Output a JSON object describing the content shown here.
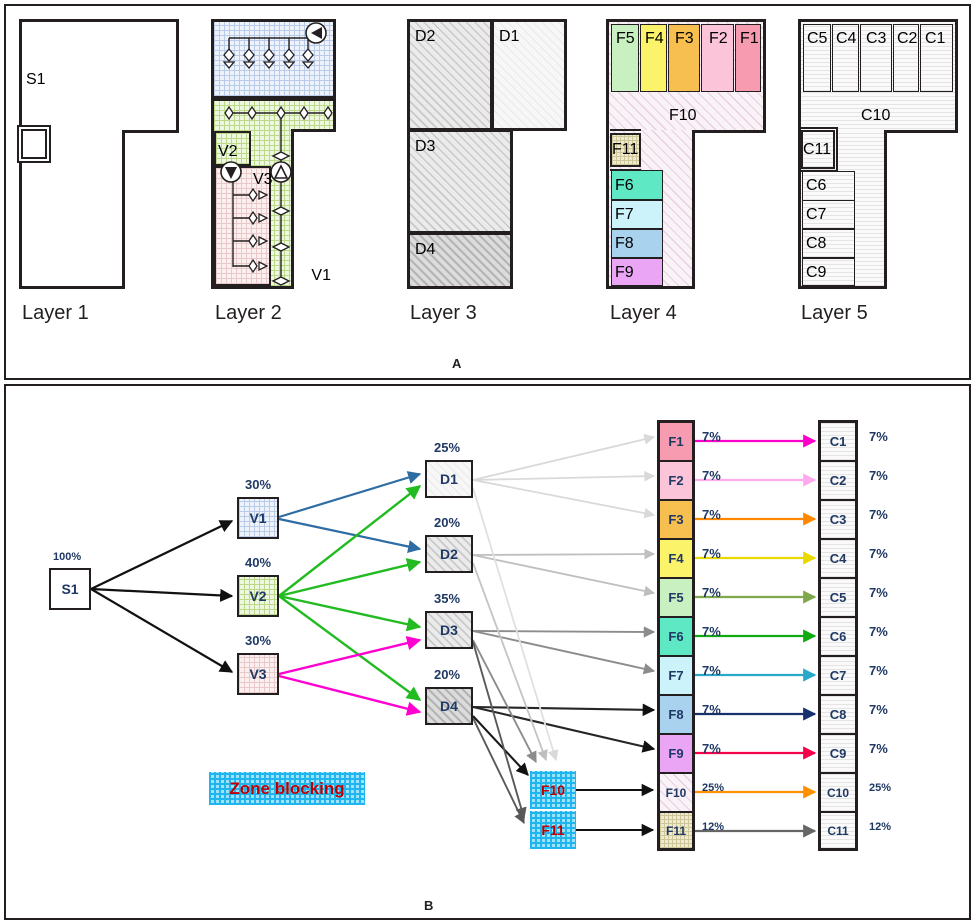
{
  "figure": {
    "panel_a_letter": "A",
    "panel_b_letter": "B"
  },
  "panel_a": {
    "captions": [
      "Layer 1",
      "Layer 2",
      "Layer 3",
      "Layer 4",
      "Layer 5"
    ],
    "layer1": {
      "rooms": [
        {
          "id": "S1"
        }
      ],
      "inset_label": ""
    },
    "layer2": {
      "zones": [
        {
          "id": "V1",
          "color": "#eef3fb"
        },
        {
          "id": "V2",
          "color": "#eef7e0"
        },
        {
          "id": "V3",
          "color": "#fbeff0"
        }
      ],
      "icons": [
        "pump-icon",
        "fan-icon",
        "damper-icon",
        "diffuser-icon"
      ]
    },
    "layer3": {
      "rooms": [
        "D2",
        "D1",
        "D3",
        "D4"
      ]
    },
    "layer4": {
      "top_rooms": [
        {
          "id": "F5",
          "color": "#c8f0c0"
        },
        {
          "id": "F4",
          "color": "#fbf46a"
        },
        {
          "id": "F3",
          "color": "#f6bf4f"
        },
        {
          "id": "F2",
          "color": "#fbc4d8"
        },
        {
          "id": "F1",
          "color": "#f79cb0"
        }
      ],
      "corridor": {
        "id": "F10"
      },
      "left_rooms": [
        {
          "id": "F11",
          "color": "#eeead0"
        },
        {
          "id": "F6",
          "color": "#5fe8c4"
        },
        {
          "id": "F7",
          "color": "#ccf3fa"
        },
        {
          "id": "F8",
          "color": "#a9d2ee"
        },
        {
          "id": "F9",
          "color": "#eaa6f4"
        }
      ]
    },
    "layer5": {
      "top_rooms": [
        "C5",
        "C4",
        "C3",
        "C2",
        "C1"
      ],
      "corridor": "C10",
      "left_rooms": [
        "C11",
        "C6",
        "C7",
        "C8",
        "C9"
      ]
    }
  },
  "panel_b": {
    "source": {
      "id": "S1",
      "pct": "100%"
    },
    "ahus": [
      {
        "id": "V1",
        "pct": "30%",
        "color": "#eef3fb",
        "arrow_color": "#2e6da4"
      },
      {
        "id": "V2",
        "pct": "40%",
        "color": "#eef7e0",
        "arrow_color": "#22bb22"
      },
      {
        "id": "V3",
        "pct": "30%",
        "color": "#fbeff0",
        "arrow_color": "#ff00d0"
      }
    ],
    "dampers": [
      {
        "id": "D1",
        "pct": "25%"
      },
      {
        "id": "D2",
        "pct": "20%"
      },
      {
        "id": "D3",
        "pct": "35%"
      },
      {
        "id": "D4",
        "pct": "20%"
      }
    ],
    "zone_blocking_nodes": [
      {
        "id": "F10"
      },
      {
        "id": "F11"
      }
    ],
    "legend": {
      "label": "Zone blocking"
    },
    "rooms": [
      {
        "f": "F1",
        "f_pct": "7%",
        "c": "C1",
        "c_pct": "7%",
        "color": "#f79cb0",
        "link": "#ff00cc"
      },
      {
        "f": "F2",
        "f_pct": "7%",
        "c": "C2",
        "c_pct": "7%",
        "color": "#fbc4d8",
        "link": "#ffaaee"
      },
      {
        "f": "F3",
        "f_pct": "7%",
        "c": "C3",
        "c_pct": "7%",
        "color": "#f6bf4f",
        "link": "#ff8800"
      },
      {
        "f": "F4",
        "f_pct": "7%",
        "c": "C4",
        "c_pct": "7%",
        "color": "#fbf46a",
        "link": "#e8d900"
      },
      {
        "f": "F5",
        "f_pct": "7%",
        "c": "C5",
        "c_pct": "7%",
        "color": "#c8f0c0",
        "link": "#7fa84a"
      },
      {
        "f": "F6",
        "f_pct": "7%",
        "c": "C6",
        "c_pct": "7%",
        "color": "#5fe8c4",
        "link": "#12aa12"
      },
      {
        "f": "F7",
        "f_pct": "7%",
        "c": "C7",
        "c_pct": "7%",
        "color": "#ccf3fa",
        "link": "#2aa8c8"
      },
      {
        "f": "F8",
        "f_pct": "7%",
        "c": "C8",
        "c_pct": "7%",
        "color": "#a9d2ee",
        "link": "#16306e"
      },
      {
        "f": "F9",
        "f_pct": "7%",
        "c": "C9",
        "c_pct": "7%",
        "color": "#eaa6f4",
        "link": "#f4004a"
      },
      {
        "f": "F10",
        "f_pct": "25%",
        "c": "C10",
        "c_pct": "25%",
        "color": "#fbf3fa",
        "link": "#ff9000"
      },
      {
        "f": "F11",
        "f_pct": "12%",
        "c": "C11",
        "c_pct": "12%",
        "color": "#eeead0",
        "link": "#666666"
      }
    ]
  },
  "chart_data": {
    "type": "diagram",
    "title": "Five-layer building system model and flow distribution graph",
    "nodes": {
      "source": [
        "S1"
      ],
      "ventilation": [
        "V1",
        "V2",
        "V3"
      ],
      "dampers": [
        "D1",
        "D2",
        "D3",
        "D4"
      ],
      "floors": [
        "F1",
        "F2",
        "F3",
        "F4",
        "F5",
        "F6",
        "F7",
        "F8",
        "F9",
        "F10",
        "F11"
      ],
      "conditioned": [
        "C1",
        "C2",
        "C3",
        "C4",
        "C5",
        "C6",
        "C7",
        "C8",
        "C9",
        "C10",
        "C11"
      ]
    },
    "node_values": {
      "S1": "100%",
      "V1": "30%",
      "V2": "40%",
      "V3": "30%",
      "D1": "25%",
      "D2": "20%",
      "D3": "35%",
      "D4": "20%",
      "F1": "7%",
      "F2": "7%",
      "F3": "7%",
      "F4": "7%",
      "F5": "7%",
      "F6": "7%",
      "F7": "7%",
      "F8": "7%",
      "F9": "7%",
      "F10": "25%",
      "F11": "12%",
      "C1": "7%",
      "C2": "7%",
      "C3": "7%",
      "C4": "7%",
      "C5": "7%",
      "C6": "7%",
      "C7": "7%",
      "C8": "7%",
      "C9": "7%",
      "C10": "25%",
      "C11": "12%"
    },
    "edges": [
      {
        "from": "S1",
        "to": "V1"
      },
      {
        "from": "S1",
        "to": "V2"
      },
      {
        "from": "S1",
        "to": "V3"
      },
      {
        "from": "V1",
        "to": "D1"
      },
      {
        "from": "V1",
        "to": "D2"
      },
      {
        "from": "V2",
        "to": "D1"
      },
      {
        "from": "V2",
        "to": "D2"
      },
      {
        "from": "V2",
        "to": "D3"
      },
      {
        "from": "V2",
        "to": "D4"
      },
      {
        "from": "V3",
        "to": "D3"
      },
      {
        "from": "V3",
        "to": "D4"
      },
      {
        "from": "D1",
        "to": "F1"
      },
      {
        "from": "D1",
        "to": "F2"
      },
      {
        "from": "D1",
        "to": "F3"
      },
      {
        "from": "D2",
        "to": "F4"
      },
      {
        "from": "D2",
        "to": "F5"
      },
      {
        "from": "D3",
        "to": "F6"
      },
      {
        "from": "D3",
        "to": "F7"
      },
      {
        "from": "D4",
        "to": "F8"
      },
      {
        "from": "D4",
        "to": "F9"
      },
      {
        "from": "D1",
        "to": "F10"
      },
      {
        "from": "D2",
        "to": "F10"
      },
      {
        "from": "D3",
        "to": "F10"
      },
      {
        "from": "D4",
        "to": "F10"
      },
      {
        "from": "D3",
        "to": "F11"
      },
      {
        "from": "D4",
        "to": "F11"
      },
      {
        "from": "F1",
        "to": "C1"
      },
      {
        "from": "F2",
        "to": "C2"
      },
      {
        "from": "F3",
        "to": "C3"
      },
      {
        "from": "F4",
        "to": "C4"
      },
      {
        "from": "F5",
        "to": "C5"
      },
      {
        "from": "F6",
        "to": "C6"
      },
      {
        "from": "F7",
        "to": "C7"
      },
      {
        "from": "F8",
        "to": "C8"
      },
      {
        "from": "F9",
        "to": "C9"
      },
      {
        "from": "F10",
        "to": "C10"
      },
      {
        "from": "F11",
        "to": "C11"
      }
    ]
  }
}
